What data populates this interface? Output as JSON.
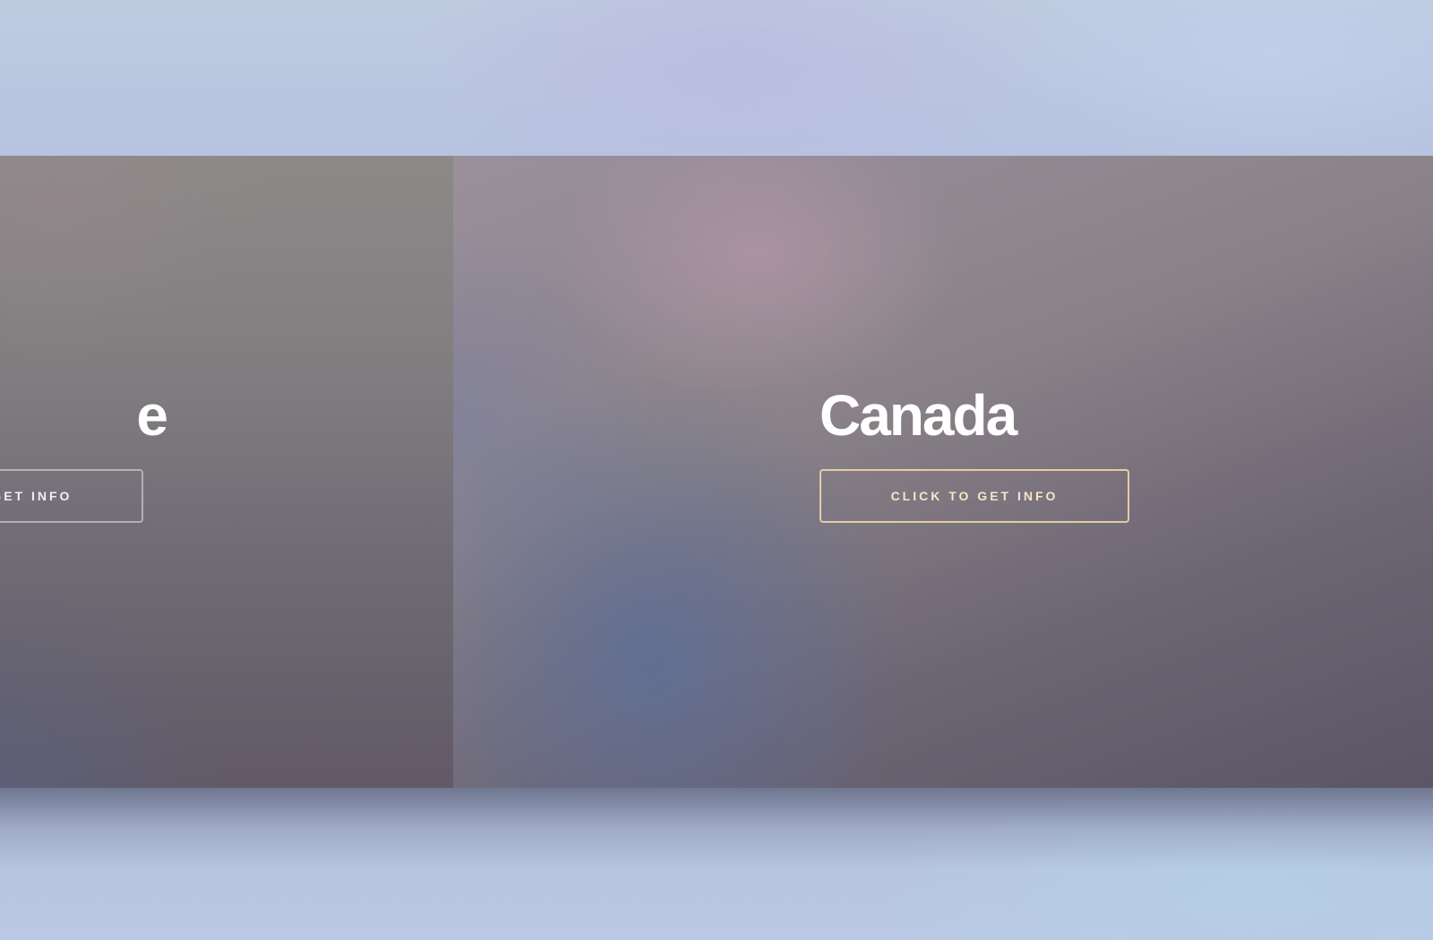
{
  "slides": {
    "left": {
      "title": "e",
      "button_label": "CLICK TO GET INFO"
    },
    "right": {
      "title": "Canada",
      "button_label": "CLICK TO GET INFO"
    }
  },
  "colors": {
    "title_text": "#ffffff",
    "active_button_border": "#e4cda2",
    "inactive_button_border": "#c8c6ce"
  }
}
